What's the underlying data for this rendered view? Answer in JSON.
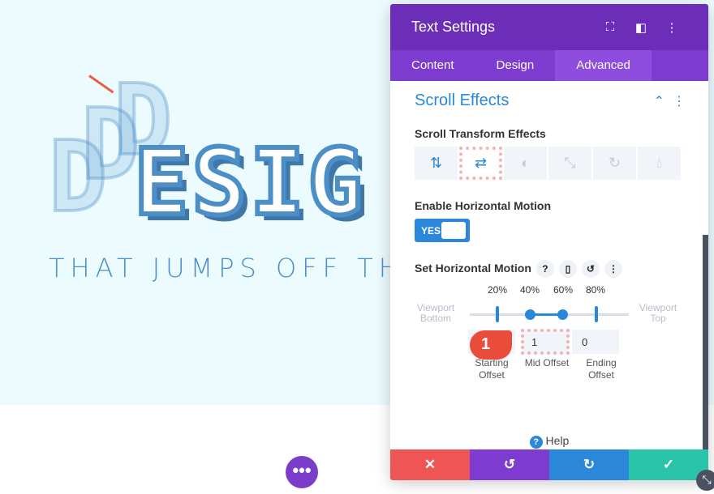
{
  "canvas": {
    "headline": "ESIG",
    "ghost": "DD",
    "subline": "THAT JUMPS OFF TH",
    "more": "•••"
  },
  "panel": {
    "title": "Text Settings",
    "header_icons": [
      "fullscreen-icon",
      "columns-icon",
      "more-vertical-icon"
    ],
    "tabs": [
      {
        "label": "Content"
      },
      {
        "label": "Design"
      },
      {
        "label": "Advanced",
        "active": true
      }
    ],
    "section": "Scroll Effects",
    "scroll_transform_label": "Scroll Transform Effects",
    "effects": [
      "vertical-motion",
      "horizontal-motion",
      "fading",
      "scaling",
      "rotating",
      "blur"
    ],
    "selected_effect": "horizontal-motion",
    "enable_label": "Enable Horizontal Motion",
    "toggle": "YES",
    "set_label": "Set Horizontal Motion",
    "ticks": [
      "20%",
      "40%",
      "60%",
      "80%"
    ],
    "viewport_bottom": "Viewport Bottom",
    "viewport_top": "Viewport Top",
    "offsets": {
      "starting": {
        "label": "Starting Offset",
        "value": ""
      },
      "mid": {
        "label": "Mid Offset",
        "value": "1"
      },
      "ending": {
        "label": "Ending Offset",
        "value": "0"
      }
    },
    "badge": "1",
    "help": "Help"
  },
  "colors": {
    "header": "#6c2eb9",
    "accent": "#2b87da",
    "cancel": "#ef5555",
    "undo": "#7e3bd0",
    "redo": "#2b87da",
    "save": "#29c4a9"
  }
}
